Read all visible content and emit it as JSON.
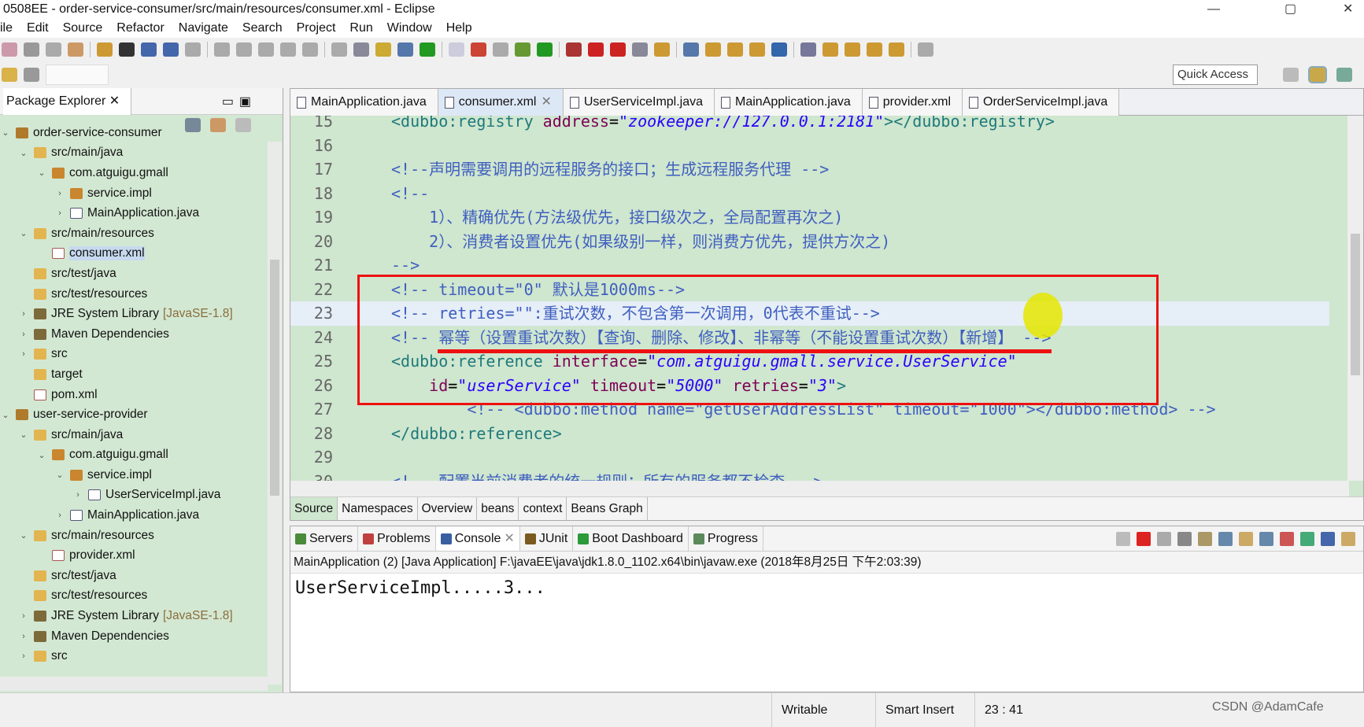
{
  "window": {
    "title": "0508EE - order-service-consumer/src/main/resources/consumer.xml - Eclipse"
  },
  "menu": [
    "ile",
    "Edit",
    "Source",
    "Refactor",
    "Navigate",
    "Search",
    "Project",
    "Run",
    "Window",
    "Help"
  ],
  "toolbar": {
    "quick_access": "Quick Access"
  },
  "package_explorer": {
    "title": "Package Explorer",
    "items": [
      {
        "level": 0,
        "arrow": "v",
        "icon": "project",
        "label": "order-service-consumer"
      },
      {
        "level": 1,
        "arrow": "v",
        "icon": "folder",
        "label": "src/main/java"
      },
      {
        "level": 2,
        "arrow": "v",
        "icon": "package",
        "label": "com.atguigu.gmall"
      },
      {
        "level": 3,
        "arrow": ">",
        "icon": "package",
        "label": "service.impl"
      },
      {
        "level": 3,
        "arrow": ">",
        "icon": "java",
        "label": "MainApplication.java"
      },
      {
        "level": 1,
        "arrow": "v",
        "icon": "folder",
        "label": "src/main/resources"
      },
      {
        "level": 2,
        "arrow": "",
        "icon": "xml",
        "label": "consumer.xml",
        "selected": true
      },
      {
        "level": 1,
        "arrow": "",
        "icon": "folder",
        "label": "src/test/java"
      },
      {
        "level": 1,
        "arrow": "",
        "icon": "folder",
        "label": "src/test/resources"
      },
      {
        "level": 1,
        "arrow": ">",
        "icon": "library",
        "label": "JRE System Library",
        "deco": "[JavaSE-1.8]"
      },
      {
        "level": 1,
        "arrow": ">",
        "icon": "library",
        "label": "Maven Dependencies"
      },
      {
        "level": 1,
        "arrow": ">",
        "icon": "folder",
        "label": "src"
      },
      {
        "level": 1,
        "arrow": "",
        "icon": "folder",
        "label": "target"
      },
      {
        "level": 1,
        "arrow": "",
        "icon": "xml",
        "label": "pom.xml"
      },
      {
        "level": 0,
        "arrow": "v",
        "icon": "project",
        "label": "user-service-provider"
      },
      {
        "level": 1,
        "arrow": "v",
        "icon": "folder",
        "label": "src/main/java"
      },
      {
        "level": 2,
        "arrow": "v",
        "icon": "package",
        "label": "com.atguigu.gmall"
      },
      {
        "level": 3,
        "arrow": "v",
        "icon": "package",
        "label": "service.impl"
      },
      {
        "level": 4,
        "arrow": ">",
        "icon": "java",
        "label": "UserServiceImpl.java"
      },
      {
        "level": 3,
        "arrow": ">",
        "icon": "java",
        "label": "MainApplication.java"
      },
      {
        "level": 1,
        "arrow": "v",
        "icon": "folder",
        "label": "src/main/resources"
      },
      {
        "level": 2,
        "arrow": "",
        "icon": "xml",
        "label": "provider.xml"
      },
      {
        "level": 1,
        "arrow": "",
        "icon": "folder",
        "label": "src/test/java"
      },
      {
        "level": 1,
        "arrow": "",
        "icon": "folder",
        "label": "src/test/resources"
      },
      {
        "level": 1,
        "arrow": ">",
        "icon": "library",
        "label": "JRE System Library",
        "deco": "[JavaSE-1.8]"
      },
      {
        "level": 1,
        "arrow": ">",
        "icon": "library",
        "label": "Maven Dependencies"
      },
      {
        "level": 1,
        "arrow": ">",
        "icon": "folder",
        "label": "src"
      }
    ]
  },
  "editor": {
    "tabs": [
      {
        "label": "MainApplication.java"
      },
      {
        "label": "consumer.xml",
        "active": true
      },
      {
        "label": "UserServiceImpl.java"
      },
      {
        "label": "MainApplication.java"
      },
      {
        "label": "provider.xml"
      },
      {
        "label": "OrderServiceImpl.java"
      }
    ],
    "lines": [
      {
        "n": "15",
        "indent": 0,
        "tokens": [
          [
            "tag",
            "<dubbo:registry "
          ],
          [
            "attr",
            "address"
          ],
          [
            "eq",
            "="
          ],
          [
            "val",
            "\"zookeeper://127.0.0.1:2181\""
          ],
          [
            "tag",
            "></dubbo:registry>"
          ]
        ]
      },
      {
        "n": "16",
        "indent": 0,
        "tokens": []
      },
      {
        "n": "17",
        "indent": 0,
        "tokens": [
          [
            "com",
            "<!--声明需要调用的远程服务的接口；生成远程服务代理 -->"
          ]
        ]
      },
      {
        "n": "18",
        "indent": 0,
        "tokens": [
          [
            "com",
            "<!--"
          ]
        ]
      },
      {
        "n": "19",
        "indent": 1,
        "tokens": [
          [
            "com",
            "    1）、精确优先(方法级优先，接口级次之，全局配置再次之)"
          ]
        ]
      },
      {
        "n": "20",
        "indent": 1,
        "tokens": [
          [
            "com",
            "    2）、消费者设置优先(如果级别一样，则消费方优先，提供方次之)"
          ]
        ]
      },
      {
        "n": "21",
        "indent": 0,
        "tokens": [
          [
            "com",
            "-->"
          ]
        ]
      },
      {
        "n": "22",
        "indent": 0,
        "tokens": [
          [
            "com",
            "<!-- timeout=\"0\" 默认是1000ms-->"
          ]
        ]
      },
      {
        "n": "23",
        "indent": 0,
        "current": true,
        "tokens": [
          [
            "com",
            "<!-- retries=\"\":重试次数，不包含第一次调用，0代表不重试-->"
          ]
        ]
      },
      {
        "n": "24",
        "indent": 0,
        "tokens": [
          [
            "com",
            "<!-- 幂等（设置重试次数）【查询、删除、修改】、非幂等（不能设置重试次数）【新增】 -->"
          ]
        ]
      },
      {
        "n": "25",
        "indent": 0,
        "tokens": [
          [
            "tag",
            "<dubbo:reference "
          ],
          [
            "attr",
            "interface"
          ],
          [
            "eq",
            "="
          ],
          [
            "val",
            "\"com.atguigu.gmall.service.UserService\""
          ]
        ]
      },
      {
        "n": "26",
        "indent": 0,
        "tokens": [
          [
            "attr",
            "    id"
          ],
          [
            "eq",
            "="
          ],
          [
            "val",
            "\"userService\""
          ],
          [
            "attr",
            " timeout"
          ],
          [
            "eq",
            "="
          ],
          [
            "val",
            "\"5000\""
          ],
          [
            "attr",
            " retries"
          ],
          [
            "eq",
            "="
          ],
          [
            "val",
            "\"3\""
          ],
          [
            "tag",
            ">"
          ]
        ]
      },
      {
        "n": "27",
        "indent": 0,
        "tokens": [
          [
            "com",
            "        <!-- <dubbo:method name=\"getUserAddressList\" timeout=\"1000\"></dubbo:method> -->"
          ]
        ]
      },
      {
        "n": "28",
        "indent": 0,
        "tokens": [
          [
            "tag",
            "</dubbo:reference>"
          ]
        ]
      },
      {
        "n": "29",
        "indent": 0,
        "tokens": []
      },
      {
        "n": "30",
        "indent": 0,
        "tokens": [
          [
            "com",
            "<!-- 配置当前消费者的统一规则：所有的服务都不检查 -->"
          ]
        ]
      }
    ],
    "source_tabs": [
      {
        "label": "Source",
        "active": true
      },
      {
        "label": "Namespaces"
      },
      {
        "label": "Overview"
      },
      {
        "label": "beans"
      },
      {
        "label": "context"
      },
      {
        "label": "Beans Graph"
      }
    ]
  },
  "bottom": {
    "tabs": [
      {
        "label": "Servers",
        "color": "#4a8a3a"
      },
      {
        "label": "Problems",
        "color": "#c04040"
      },
      {
        "label": "Console",
        "color": "#3a5fa0",
        "active": true
      },
      {
        "label": "JUnit",
        "color": "#7a5a20"
      },
      {
        "label": "Boot Dashboard",
        "color": "#2a9a3a"
      },
      {
        "label": "Progress",
        "color": "#5a8a5a"
      }
    ],
    "console_header": "MainApplication (2) [Java Application] F:\\javaEE\\java\\jdk1.8.0_1102.x64\\bin\\javaw.exe (2018年8月25日 下午2:03:39)",
    "output": "UserServiceImpl.....3..."
  },
  "status": {
    "writable": "Writable",
    "insert_mode": "Smart Insert",
    "position": "23 : 41"
  },
  "watermark": "CSDN @AdamCafe",
  "colors": {
    "editor_bg": "#cfe6cf",
    "highlight_box": "#ee1111"
  }
}
